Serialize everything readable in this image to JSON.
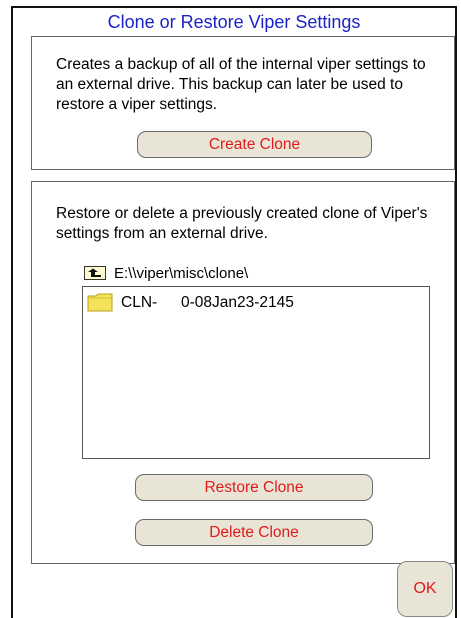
{
  "window": {
    "title": "Clone or Restore Viper Settings"
  },
  "backup_panel": {
    "description": "Creates a backup of all of the internal viper settings to an external drive.  This backup can later be used to restore a viper settings.",
    "create_label": "Create Clone"
  },
  "restore_panel": {
    "description": "Restore or delete a previously created clone of Viper's settings from an external drive.",
    "path": "E:\\\\viper\\misc\\clone\\",
    "files": [
      {
        "name": "CLN-",
        "date": "0-08Jan23-2145"
      }
    ],
    "restore_label": "Restore Clone",
    "delete_label": "Delete Clone"
  },
  "footer": {
    "ok_label": "OK"
  },
  "colors": {
    "title": "#1a22c8",
    "button_text": "#e11b1b",
    "button_bg": "#e9e5d6",
    "folder": "#f3e25a"
  },
  "icons": {
    "up_folder": "folder-up-icon",
    "folder": "folder-icon"
  }
}
